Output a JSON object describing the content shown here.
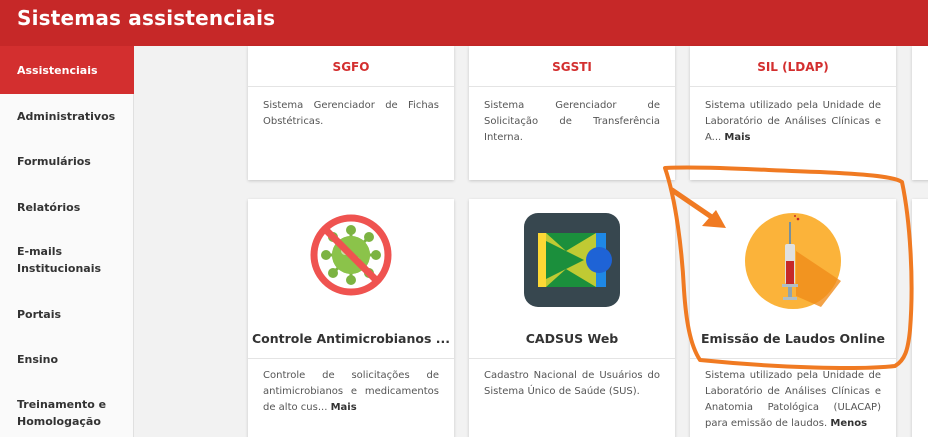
{
  "header": {
    "title": "Sistemas assistenciais"
  },
  "sidebar": {
    "items": [
      {
        "label": "Assistenciais"
      },
      {
        "label": "Administrativos"
      },
      {
        "label": "Formulários"
      },
      {
        "label": "Relatórios"
      },
      {
        "label": "E-mails Institucionais"
      },
      {
        "label": "Portais"
      },
      {
        "label": "Ensino"
      },
      {
        "label": "Treinamento e Homologação"
      }
    ]
  },
  "cards": {
    "sgfo": {
      "title": "SGFO",
      "desc": "Sistema Gerenciador de Fichas Obstétricas."
    },
    "sgsti": {
      "title": "SGSTI",
      "desc": "Sistema Gerenciador de Solicitação de Transferência Interna."
    },
    "sil": {
      "title": "SIL (LDAP)",
      "desc": "Sistema utilizado pela Unidade de Laboratório de Análises Clínicas e A...",
      "more": "Mais"
    },
    "controle": {
      "title": "Controle Antimicrobianos ...",
      "desc": "Controle de solicitações de antimicrobianos e medicamentos de alto cus...",
      "more": "Mais"
    },
    "cadsus": {
      "title": "CADSUS Web",
      "desc": "Cadastro Nacional de Usuários do Sistema Único de Saúde (SUS)."
    },
    "laudos": {
      "title": "Emissão de Laudos Online",
      "desc": "Sistema utilizado pela Unidade de Laboratório de Análises Clínicas e Anatomia Patológica (ULACAP) para emissão de laudos.",
      "less": "Menos"
    }
  },
  "colors": {
    "brand_red": "#c62828",
    "annotation_orange": "#f07a22"
  }
}
